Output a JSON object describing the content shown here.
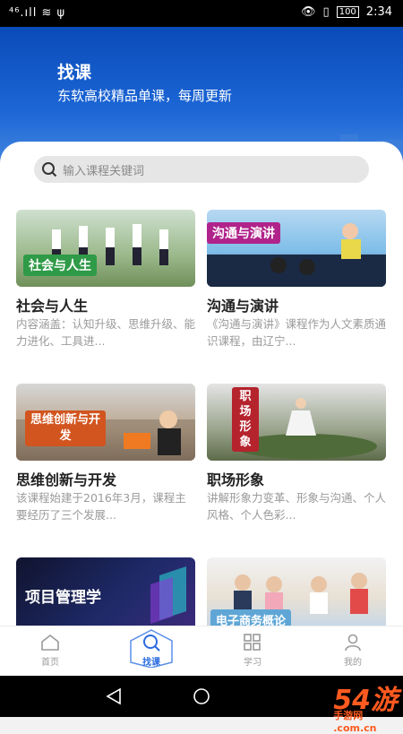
{
  "status_bar": {
    "left": "⁴⁶.ıll ≋ ψ",
    "battery": "100",
    "time": "2:34"
  },
  "header": {
    "title": "找课",
    "subtitle": "东软高校精品单课，每周更新"
  },
  "search": {
    "placeholder": "输入课程关键词"
  },
  "courses": [
    {
      "title": "社会与人生",
      "tag": "社会与人生",
      "desc": "内容涵盖：认知升级、思维升级、能力进化、工具进..."
    },
    {
      "title": "沟通与演讲",
      "tag": "沟通与演讲",
      "desc": "《沟通与演讲》课程作为人文素质通识课程，由辽宁..."
    },
    {
      "title": "思维创新与开发",
      "tag": "思维创新与开发",
      "desc": "该课程始建于2016年3月，课程主要经历了三个发展..."
    },
    {
      "title": "职场形象",
      "tag": "职场形象",
      "desc": "讲解形象力变革、形象与沟通、个人风格、个人色彩..."
    },
    {
      "title": "",
      "tag": "项目管理学",
      "desc": ""
    },
    {
      "title": "",
      "tag": "电子商务概论",
      "desc": ""
    }
  ],
  "tabs": [
    {
      "label": "首页",
      "icon": "home-icon"
    },
    {
      "label": "找课",
      "icon": "search-icon",
      "active": true
    },
    {
      "label": "学习",
      "icon": "grid-icon"
    },
    {
      "label": "我的",
      "icon": "person-icon"
    }
  ],
  "colors": {
    "brand": "#1c66d6",
    "accent": "#2a6be0"
  },
  "watermark": {
    "brand": "54游",
    "sub": "手游网 .com.cn"
  }
}
